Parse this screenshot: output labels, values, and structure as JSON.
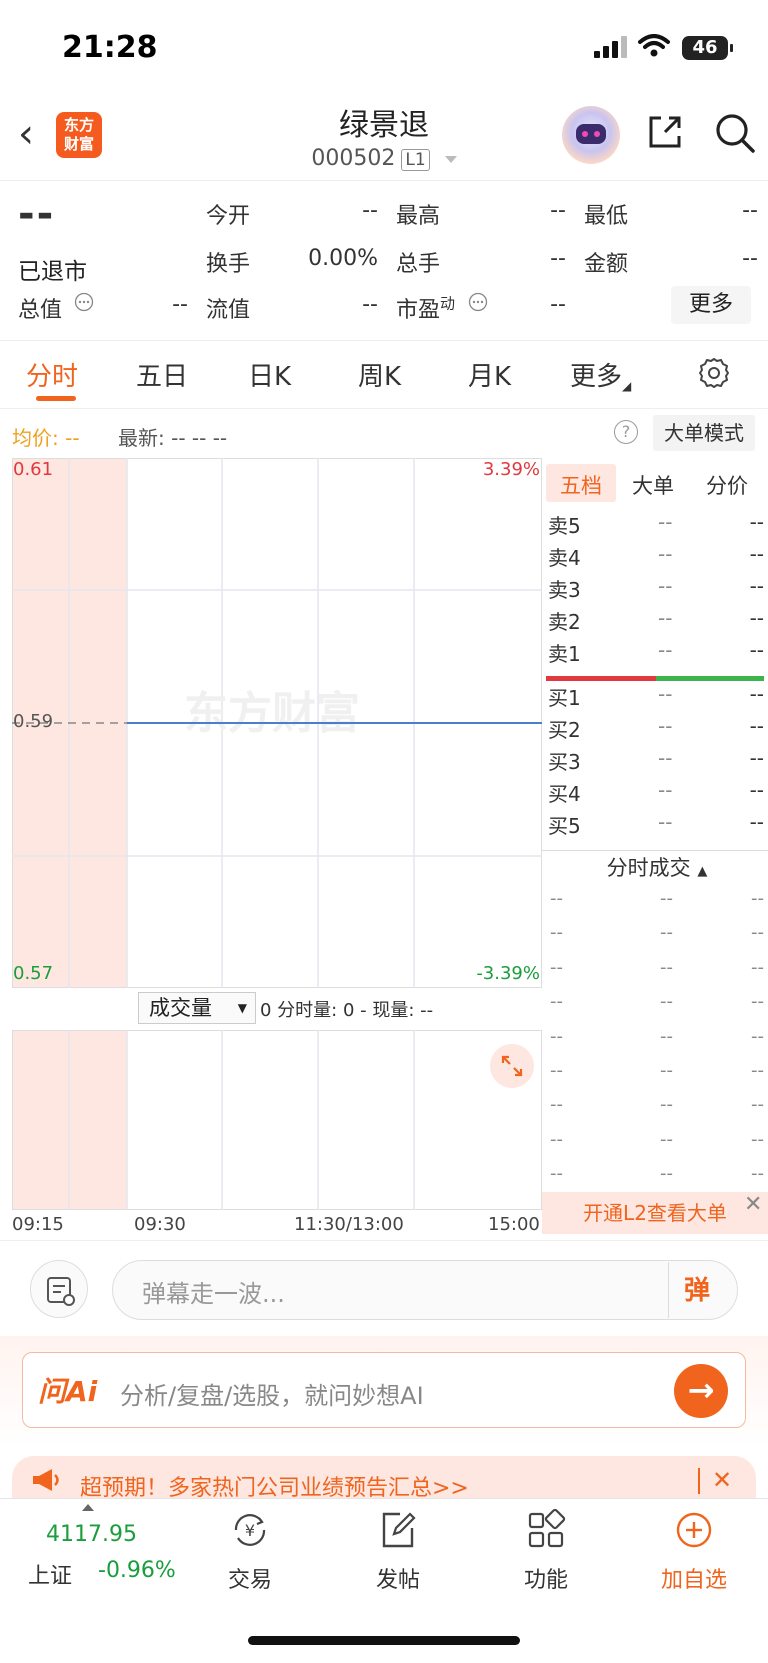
{
  "status_bar": {
    "time": "21:28",
    "battery": "46"
  },
  "header": {
    "logo": "东方\n财富",
    "stock_name": "绿景退",
    "stock_code": "000502",
    "level_badge": "L1"
  },
  "quote": {
    "price": "--",
    "status": "已退市",
    "fields": {
      "open_label": "今开",
      "open_value": "--",
      "high_label": "最高",
      "high_value": "--",
      "low_label": "最低",
      "low_value": "--",
      "turnover_label": "换手",
      "turnover_value": "0.00%",
      "volume_label": "总手",
      "volume_value": "--",
      "amount_label": "金额",
      "amount_value": "--",
      "mktcap_label": "总值",
      "mktcap_value": "--",
      "float_label": "流值",
      "float_value": "--",
      "pe_label": "市盈",
      "pe_sup": "动",
      "pe_value": "--"
    },
    "more_label": "更多"
  },
  "tabs": [
    "分时",
    "五日",
    "日K",
    "周K",
    "月K",
    "更多"
  ],
  "info_row": {
    "avg_label": "均价:",
    "avg_value": "--",
    "latest_label": "最新:",
    "latest_value": "-- -- --",
    "bigmode_label": "大单模式"
  },
  "chart_data": {
    "type": "line",
    "title": "",
    "y_ticks": {
      "top": "0.61",
      "mid": "0.59",
      "bottom": "0.57"
    },
    "pct_ticks": {
      "top": "3.39%",
      "bottom": "-3.39%"
    },
    "ylim": [
      0.57,
      0.61
    ],
    "x_labels": [
      "09:15",
      "09:30",
      "11:30/13:00",
      "15:00"
    ],
    "series": [
      {
        "values": [
          0.59,
          0.59
        ]
      }
    ],
    "colors": {
      "line": "#4a7fd0",
      "up": "#e0393e",
      "down": "#1a9e3c"
    },
    "watermark": "东方财富",
    "volume_selector": "成交量",
    "volume_info": "0 分时量: 0 - 现量: --"
  },
  "order_book": {
    "tabs": [
      "五档",
      "大单",
      "分价"
    ],
    "asks": [
      {
        "name": "卖5",
        "price": "--",
        "vol": "--"
      },
      {
        "name": "卖4",
        "price": "--",
        "vol": "--"
      },
      {
        "name": "卖3",
        "price": "--",
        "vol": "--"
      },
      {
        "name": "卖2",
        "price": "--",
        "vol": "--"
      },
      {
        "name": "卖1",
        "price": "--",
        "vol": "--"
      }
    ],
    "bids": [
      {
        "name": "买1",
        "price": "--",
        "vol": "--"
      },
      {
        "name": "买2",
        "price": "--",
        "vol": "--"
      },
      {
        "name": "买3",
        "price": "--",
        "vol": "--"
      },
      {
        "name": "买4",
        "price": "--",
        "vol": "--"
      },
      {
        "name": "买5",
        "price": "--",
        "vol": "--"
      }
    ],
    "ticks_header": "分时成交",
    "ticks": [
      [
        "--",
        "--",
        "--"
      ],
      [
        "--",
        "--",
        "--"
      ],
      [
        "--",
        "--",
        "--"
      ],
      [
        "--",
        "--",
        "--"
      ],
      [
        "--",
        "--",
        "--"
      ],
      [
        "--",
        "--",
        "--"
      ],
      [
        "--",
        "--",
        "--"
      ],
      [
        "--",
        "--",
        "--"
      ],
      [
        "--",
        "--",
        "--"
      ]
    ],
    "l2_banner": "开通L2查看大单"
  },
  "danmaku": {
    "placeholder": "弹幕走一波...",
    "button": "弹"
  },
  "ai": {
    "logo": "问Ai",
    "placeholder": "分析/复盘/选股，就问妙想AI"
  },
  "notice": {
    "text": "超预期！多家热门公司业绩预告汇总>>"
  },
  "tabbar": {
    "index_value": "4117.95",
    "index_name": "上证",
    "index_change": "-0.96%",
    "items": [
      "交易",
      "发帖",
      "功能",
      "加自选"
    ]
  }
}
